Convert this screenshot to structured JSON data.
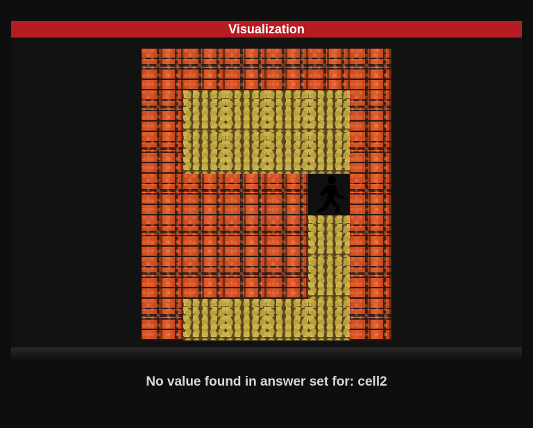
{
  "header": {
    "title": "Visualization"
  },
  "colors": {
    "header_bar": "#b71c22",
    "background": "#0e0e0e",
    "wall": "#c4461c",
    "floor": "#b8a03c",
    "player_tile": "#101010"
  },
  "grid": {
    "rows": [
      [
        "wall",
        "wall",
        "wall",
        "wall",
        "wall",
        "wall"
      ],
      [
        "wall",
        "floor",
        "floor",
        "floor",
        "floor",
        "wall"
      ],
      [
        "wall",
        "floor",
        "floor",
        "floor",
        "floor",
        "wall"
      ],
      [
        "wall",
        "wall",
        "wall",
        "wall",
        "player",
        "wall"
      ],
      [
        "wall",
        "wall",
        "wall",
        "wall",
        "floor",
        "wall"
      ],
      [
        "wall",
        "wall",
        "wall",
        "wall",
        "floor",
        "wall"
      ],
      [
        "wall",
        "floor",
        "floor",
        "floor",
        "floor",
        "wall"
      ]
    ],
    "player_icon": "walking-person-icon"
  },
  "status": {
    "message": "No value found in answer set for: cell2"
  }
}
